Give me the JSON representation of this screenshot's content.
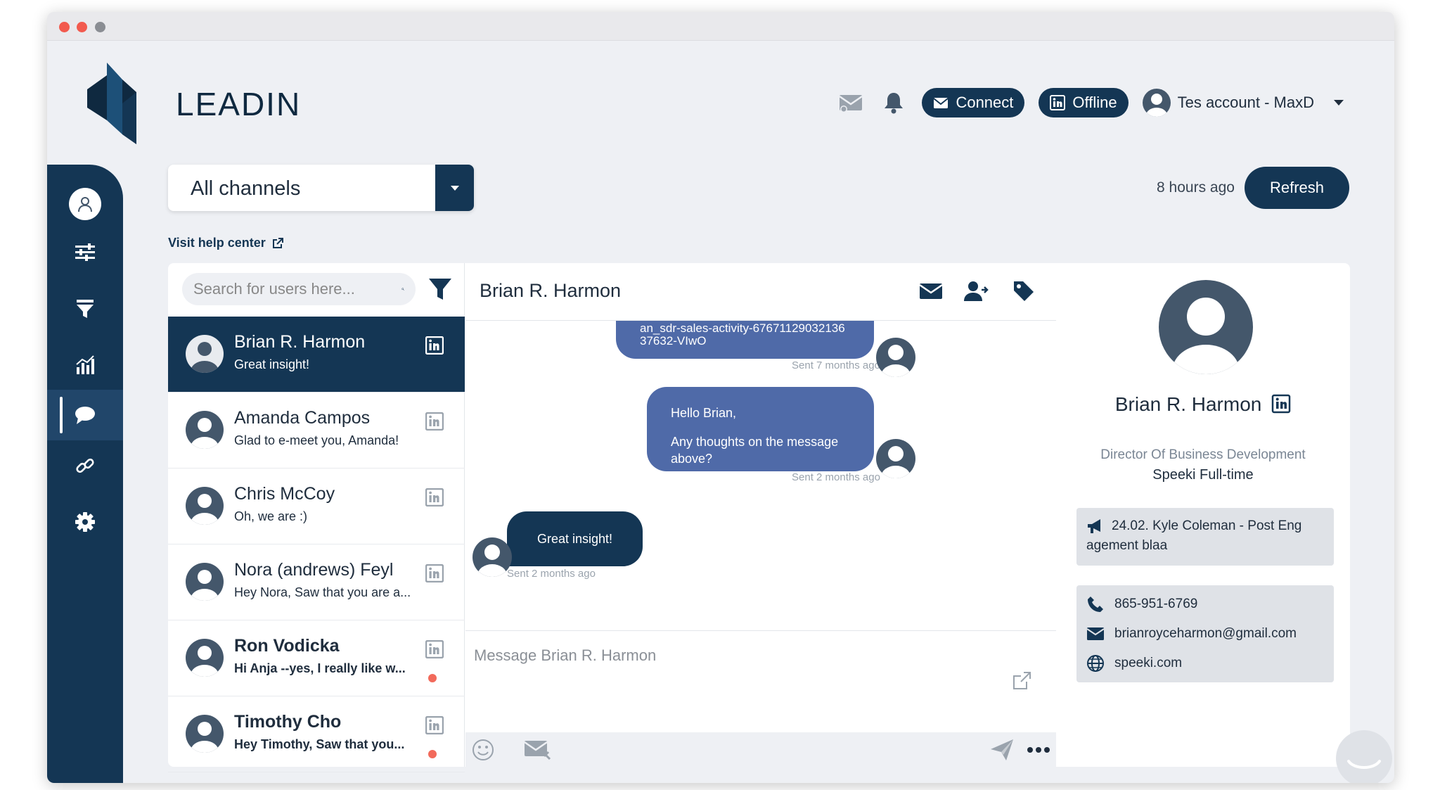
{
  "brand": {
    "name": "LEADIN"
  },
  "header": {
    "connect_label": "Connect",
    "offline_label": "Offline",
    "account_label": "Tes account - MaxD"
  },
  "toolbar": {
    "channel_selected": "All channels",
    "help_label": "Visit help center",
    "last_sync": "8 hours ago",
    "refresh_label": "Refresh"
  },
  "sidebar": {
    "items": [
      {
        "icon": "user-avatar-icon"
      },
      {
        "icon": "sliders-icon"
      },
      {
        "icon": "funnel-icon"
      },
      {
        "icon": "bar-chart-icon"
      },
      {
        "icon": "chat-bubble-icon",
        "active": true
      },
      {
        "icon": "link-icon"
      },
      {
        "icon": "gear-icon"
      }
    ]
  },
  "search": {
    "placeholder": "Search for users here..."
  },
  "conversations": [
    {
      "name": "Brian R. Harmon",
      "preview": "Great insight!",
      "active": true,
      "unread": false
    },
    {
      "name": "Amanda Campos",
      "preview": "Glad to e-meet you, Amanda!",
      "active": false,
      "unread": false
    },
    {
      "name": "Chris McCoy",
      "preview": "Oh, we are :)",
      "active": false,
      "unread": false
    },
    {
      "name": "Nora (andrews) Feyl",
      "preview": "Hey Nora, Saw that you are a...",
      "active": false,
      "unread": false
    },
    {
      "name": "Ron Vodicka",
      "preview": "Hi Anja --yes, I really like w...",
      "active": false,
      "unread": true
    },
    {
      "name": "Timothy Cho",
      "preview": "Hey Timothy, Saw that you...",
      "active": false,
      "unread": true
    }
  ],
  "chat": {
    "contact_name": "Brian R. Harmon",
    "messages": [
      {
        "text": "an_sdr-sales-activity-6767112903213637632-VIwO",
        "sent": "Sent 7 months ago",
        "outgoing": true
      },
      {
        "line1": "Hello Brian,",
        "line2": "Any thoughts on the message above?",
        "sent": "Sent 2 months ago",
        "outgoing": true
      },
      {
        "text": "Great insight!",
        "sent": "Sent 2 months ago",
        "outgoing": false
      }
    ],
    "composer_placeholder": "Message Brian R. Harmon"
  },
  "profile": {
    "name": "Brian R. Harmon",
    "title": "Director Of Business Development",
    "company": "Speeki Full-time",
    "campaign": "24.02. Kyle Coleman - Post Eng agement blaa",
    "phone": "865-951-6769",
    "email": "brianroyceharmon@gmail.com",
    "website": "speeki.com"
  },
  "colors": {
    "navy": "#143654",
    "bubble": "#4f6aa8",
    "unread_dot": "#f26a5b"
  }
}
